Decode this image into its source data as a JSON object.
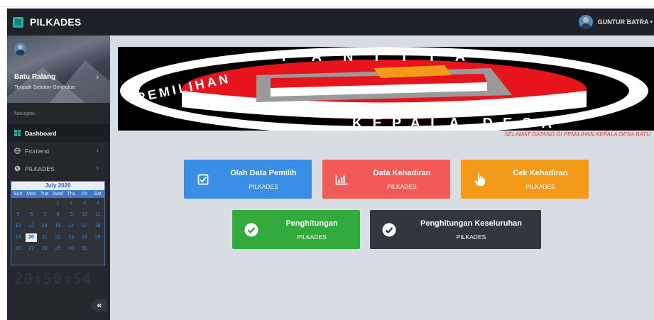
{
  "navbar": {
    "brand": "PILKADES",
    "user_name": "GUNTUR BATRA",
    "caret": "▾"
  },
  "sidebar": {
    "profile_name": "Batu Ralang",
    "profile_sub": "Teupah Selatan-Simeulue",
    "nav_header": "Navigasi",
    "items": [
      {
        "label": "Dashboard",
        "icon": "grid-icon"
      },
      {
        "label": "Frontend",
        "icon": "globe-icon"
      },
      {
        "label": "PILKADES",
        "icon": "globe-icon"
      }
    ],
    "calendar": {
      "title": "July 2020",
      "days": [
        "Sun",
        "Mon",
        "Tue",
        "Wed",
        "Thu",
        "Fri",
        "Sat"
      ],
      "cells": [
        "",
        "",
        "",
        "1",
        "2",
        "3",
        "4",
        "5",
        "6",
        "7",
        "8",
        "9",
        "10",
        "11",
        "12",
        "13",
        "14",
        "15",
        "16",
        "17",
        "18",
        "19",
        "20",
        "21",
        "22",
        "23",
        "24",
        "25",
        "26",
        "27",
        "28",
        "29",
        "30",
        "31",
        ""
      ],
      "today": "20"
    },
    "clock": "20:50:54",
    "collapse_label": "«"
  },
  "main": {
    "banner": {
      "arc_top": "PANITIA",
      "arc_left": "PEMILIHAN",
      "arc_bottom": "KEPALA DESA"
    },
    "welcome": "SELAMAT DATANG DI PEMILIHAN KEPALA DESA BATU",
    "tiles": [
      {
        "title": "Olah Data Pemilih",
        "sub": "PILKADES",
        "icon": "checkbox-icon",
        "color": "#3a8ee6"
      },
      {
        "title": "Data Kehadiran",
        "sub": "PILKADES",
        "icon": "bar-chart-icon",
        "color": "#f15a57"
      },
      {
        "title": "Cek Kehadiran",
        "sub": "PILKADES",
        "icon": "hand-pointer-icon",
        "color": "#f39a1b"
      },
      {
        "title": "Penghitungan",
        "sub": "PILKADES",
        "icon": "check-circle-icon",
        "color": "#33ab3c"
      },
      {
        "title": "Penghitungan Keseluruhan",
        "sub": "PILKADES",
        "icon": "check-circle-icon",
        "color": "#33373d"
      }
    ]
  }
}
